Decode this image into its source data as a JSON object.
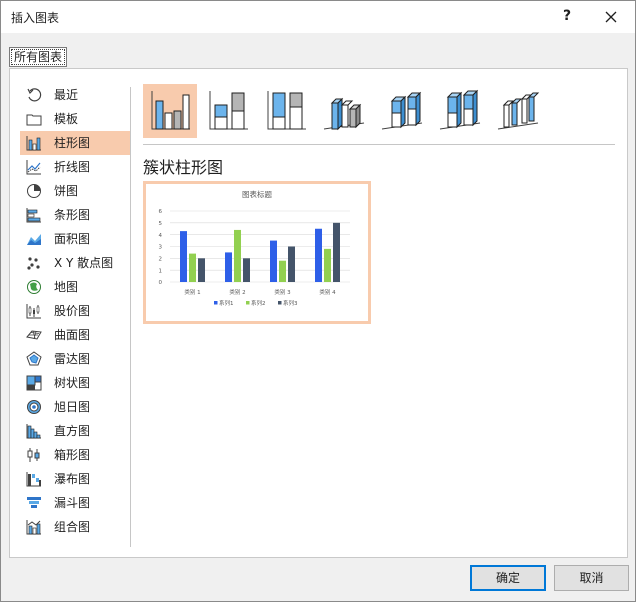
{
  "dialog": {
    "title": "插入图表",
    "help_label": "?"
  },
  "tab": {
    "label": "所有图表"
  },
  "chart_types": [
    {
      "label": "最近",
      "icon": "recent-icon"
    },
    {
      "label": "模板",
      "icon": "folder-icon"
    },
    {
      "label": "柱形图",
      "icon": "column-chart-icon",
      "selected": true
    },
    {
      "label": "折线图",
      "icon": "line-chart-icon"
    },
    {
      "label": "饼图",
      "icon": "pie-chart-icon"
    },
    {
      "label": "条形图",
      "icon": "bar-chart-icon"
    },
    {
      "label": "面积图",
      "icon": "area-chart-icon"
    },
    {
      "label": "X Y 散点图",
      "icon": "scatter-chart-icon"
    },
    {
      "label": "地图",
      "icon": "map-chart-icon"
    },
    {
      "label": "股价图",
      "icon": "stock-chart-icon"
    },
    {
      "label": "曲面图",
      "icon": "surface-chart-icon"
    },
    {
      "label": "雷达图",
      "icon": "radar-chart-icon"
    },
    {
      "label": "树状图",
      "icon": "treemap-chart-icon"
    },
    {
      "label": "旭日图",
      "icon": "sunburst-chart-icon"
    },
    {
      "label": "直方图",
      "icon": "histogram-chart-icon"
    },
    {
      "label": "箱形图",
      "icon": "box-whisker-chart-icon"
    },
    {
      "label": "瀑布图",
      "icon": "waterfall-chart-icon"
    },
    {
      "label": "漏斗图",
      "icon": "funnel-chart-icon"
    },
    {
      "label": "组合图",
      "icon": "combo-chart-icon"
    }
  ],
  "section_title": "簇状柱形图",
  "buttons": {
    "ok": "确定",
    "cancel": "取消"
  },
  "colors": {
    "selection": "#f8cbad",
    "series1": "#2e5fe8",
    "series2": "#92d050",
    "series3": "#44546a"
  },
  "chart_data": {
    "type": "bar",
    "title": "图表标题",
    "categories": [
      "类别 1",
      "类别 2",
      "类别 3",
      "类别 4"
    ],
    "series": [
      {
        "name": "系列1",
        "values": [
          4.3,
          2.5,
          3.5,
          4.5
        ]
      },
      {
        "name": "系列2",
        "values": [
          2.4,
          4.4,
          1.8,
          2.8
        ]
      },
      {
        "name": "系列3",
        "values": [
          2,
          2,
          3,
          5
        ]
      }
    ],
    "ylim": [
      0,
      6
    ],
    "yticks": [
      0,
      1,
      2,
      3,
      4,
      5,
      6
    ],
    "grid": true,
    "legend": "bottom"
  }
}
